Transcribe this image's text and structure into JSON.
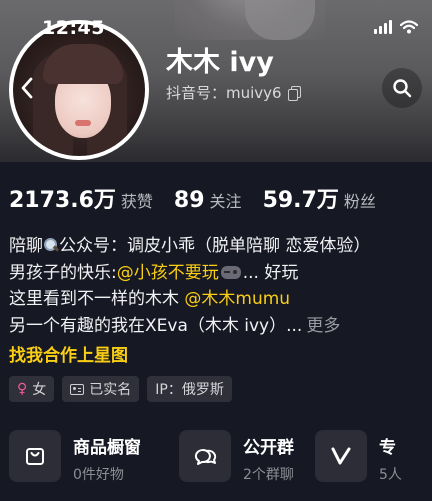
{
  "status_bar": {
    "time": "12:45",
    "icons": [
      "signal-icon",
      "wifi-icon"
    ]
  },
  "profile": {
    "name": "木木 ivy",
    "douyin_id_label": "抖音号：muivy6",
    "avatar": "avatar-photo"
  },
  "header_buttons": {
    "back": "chevron-left-icon",
    "search": "search-icon"
  },
  "stats": [
    {
      "num": "2173.6万",
      "label": "获赞"
    },
    {
      "num": "89",
      "label": "关注"
    },
    {
      "num": "59.7万",
      "label": "粉丝"
    }
  ],
  "bio": {
    "line1_a": "陪聊",
    "line1_b": "公众号：调皮小乖（脱单陪聊 恋爱体验）",
    "line2_a": "男孩子的快乐:",
    "line2_mention": "@小孩不要玩",
    "line2_b": "... 好玩",
    "line3_a": "这里看到不一样的木木",
    "line3_mention": "@木木mumu",
    "line4_a": "另一个有趣的我在XEva（木木 ivy）...",
    "line4_more": "更多",
    "star_link": "找我合作上星图"
  },
  "tags": [
    {
      "icon": "female-icon",
      "label": "女"
    },
    {
      "icon": "id-card-icon",
      "label": "已实名"
    },
    {
      "icon": "",
      "label": "IP：俄罗斯"
    }
  ],
  "cards": [
    {
      "icon": "shopping-bag-icon",
      "title": "商品橱窗",
      "sub": "0件好物"
    },
    {
      "icon": "chat-bubbles-icon",
      "title": "公开群",
      "sub": "2个群聊"
    },
    {
      "icon": "v-icon",
      "title": "专",
      "sub": "5人"
    }
  ],
  "colors": {
    "background": "#161823",
    "mention": "#face15",
    "tag_bg": "#2f3039",
    "card_icon_bg": "#2c2d36"
  }
}
